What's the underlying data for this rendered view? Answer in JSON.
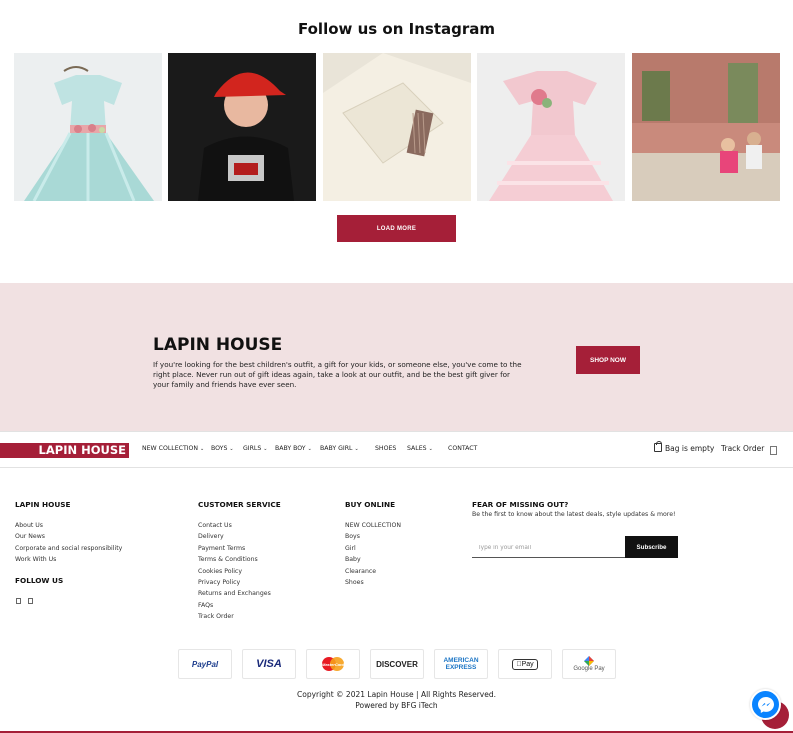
{
  "instagram": {
    "title": "Follow us on Instagram",
    "load_more": "LOAD MORE",
    "tiles": [
      "dress-mint-tulle",
      "boy-red-helmet",
      "white-shirt-detail",
      "dress-pink-tulle",
      "girls-street-photo"
    ]
  },
  "banner": {
    "title": "LAPIN HOUSE",
    "text": "If you're looking for the best children's outfit, a gift for your kids, or someone else, you've come to the right place. Never run out of gift ideas again, take a look at our outfit, and be the best gift giver for your family and friends have ever seen.",
    "cta": "SHOP NOW"
  },
  "nav": {
    "logo": "LAPIN HOUSE",
    "items": [
      {
        "label": "NEW COLLECTION",
        "dropdown": true
      },
      {
        "label": "BOYS",
        "dropdown": true
      },
      {
        "label": "GIRLS",
        "dropdown": true
      },
      {
        "label": "BABY BOY",
        "dropdown": true
      },
      {
        "label": "BABY GIRL",
        "dropdown": true
      },
      {
        "label": "SHOES",
        "dropdown": false
      },
      {
        "label": "SALES",
        "dropdown": true
      },
      {
        "label": "CONTACT",
        "dropdown": false
      }
    ],
    "bag": "Bag is empty",
    "track_order": "Track Order"
  },
  "footer": {
    "col1": {
      "title": "LAPIN HOUSE",
      "links": [
        "About Us",
        "Our News",
        "Corporate and social responsibility",
        "Work With Us"
      ]
    },
    "follow_title": "FOLLOW US",
    "col2": {
      "title": "CUSTOMER SERVICE",
      "links": [
        "Contact Us",
        "Delivery",
        "Payment Terms",
        "Terms & Conditions",
        "Cookies Policy",
        "Privacy Policy",
        "Returns and Exchanges",
        "FAQs",
        "Track Order"
      ]
    },
    "col3": {
      "title": "BUY ONLINE",
      "links": [
        "NEW COLLECTION",
        "Boys",
        "Girl",
        "Baby",
        "Clearance",
        "Shoes"
      ]
    },
    "newsletter": {
      "title": "FEAR OF MISSING OUT?",
      "text": "Be the first to know about the latest deals, style updates & more!",
      "placeholder": "Type in your email",
      "button": "Subscribe"
    },
    "payments": {
      "paypal": "PayPal",
      "visa": "VISA",
      "mastercard": "MasterCard",
      "discover": "DISCOVER",
      "amex_line1": "AMERICAN",
      "amex_line2": "EXPRESS",
      "applepay": "Pay",
      "googlepay": "Google Pay"
    },
    "copyright": "Copyright © 2021 Lapin House | All Rights Reserved.",
    "powered": "Powered by BFG iTech"
  },
  "colors": {
    "brand": "#a51f38",
    "banner_bg": "#f1e1e2",
    "messenger": "#0a84ff"
  }
}
